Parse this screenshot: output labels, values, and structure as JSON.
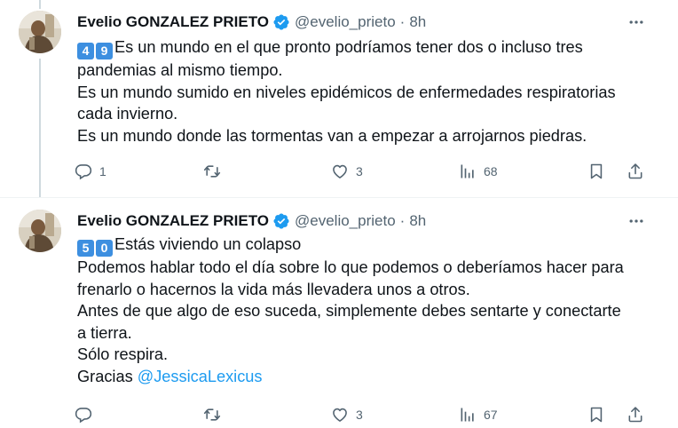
{
  "tweets": [
    {
      "author": {
        "name": "Evelio GONZALEZ PRIETO",
        "handle": "@evelio_prieto"
      },
      "separator": "·",
      "time": "8h",
      "keycaps": [
        "4",
        "9"
      ],
      "lines": [
        "Es un mundo en el que pronto podríamos tener dos o incluso tres",
        "pandemias al mismo tiempo.",
        "Es un mundo sumido en niveles epidémicos de enfermedades respiratorias",
        "cada invierno.",
        "Es un mundo donde las tormentas van a empezar a arrojarnos piedras."
      ],
      "stats": {
        "replies": "1",
        "retweets": "",
        "likes": "3",
        "views": "68"
      }
    },
    {
      "author": {
        "name": "Evelio GONZALEZ PRIETO",
        "handle": "@evelio_prieto"
      },
      "separator": "·",
      "time": "8h",
      "keycaps": [
        "5",
        "0"
      ],
      "lines": [
        "Estás viviendo un colapso",
        "Podemos hablar todo el día sobre lo que podemos o deberíamos hacer para",
        "frenarlo o hacernos la vida más llevadera unos a otros.",
        "Antes de que algo de eso suceda, simplemente debes sentarte y conectarte",
        "a tierra.",
        "Sólo respira.",
        "Gracias"
      ],
      "mention": "@JessicaLexicus",
      "stats": {
        "replies": "",
        "retweets": "",
        "likes": "3",
        "views": "67"
      }
    }
  ],
  "icons": {
    "verified": "verified-badge-icon",
    "more": "more-horizontal-icon",
    "reply": "reply-icon",
    "retweet": "retweet-icon",
    "like": "heart-icon",
    "views": "views-bar-chart-icon",
    "bookmark": "bookmark-icon",
    "share": "share-icon"
  },
  "colors": {
    "text": "#0f1419",
    "secondary": "#536471",
    "accent": "#1d9bf0",
    "thread_line": "#cfd9de",
    "keycap": "#3d8fe0"
  }
}
